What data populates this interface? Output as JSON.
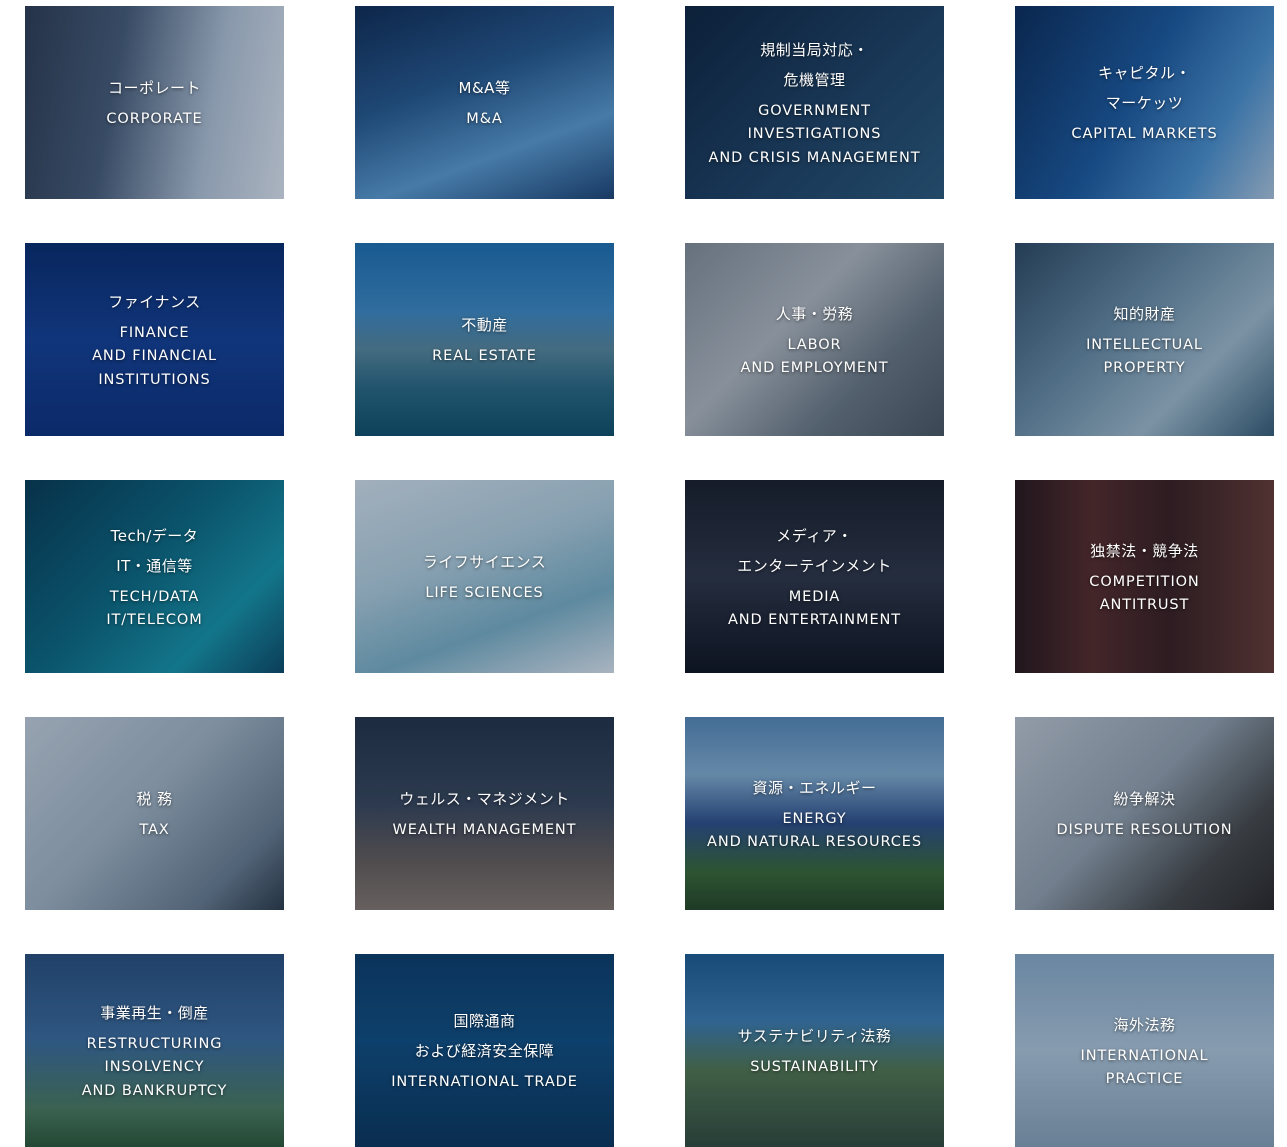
{
  "tiles": [
    {
      "jp": "コーポレート",
      "en": "CORPORATE"
    },
    {
      "jp": "M&A等",
      "en": "M&A"
    },
    {
      "jp": "規制当局対応・\n危機管理",
      "en": "GOVERNMENT\nINVESTIGATIONS\nAND CRISIS MANAGEMENT"
    },
    {
      "jp": "キャピタル・\nマーケッツ",
      "en": "CAPITAL MARKETS"
    },
    {
      "jp": "ファイナンス",
      "en": "FINANCE\nAND FINANCIAL\nINSTITUTIONS"
    },
    {
      "jp": "不動産",
      "en": "REAL ESTATE"
    },
    {
      "jp": "人事・労務",
      "en": "LABOR\nAND EMPLOYMENT"
    },
    {
      "jp": "知的財産",
      "en": "INTELLECTUAL\nPROPERTY"
    },
    {
      "jp": "Tech/データ\nIT・通信等",
      "en": "TECH/DATA\nIT/TELECOM"
    },
    {
      "jp": "ライフサイエンス",
      "en": "LIFE SCIENCES"
    },
    {
      "jp": "メディア・\nエンターテインメント",
      "en": "MEDIA\nAND ENTERTAINMENT"
    },
    {
      "jp": "独禁法・競争法",
      "en": "COMPETITION\nANTITRUST"
    },
    {
      "jp": "税 務",
      "en": "TAX"
    },
    {
      "jp": "ウェルス・マネジメント",
      "en": "WEALTH MANAGEMENT"
    },
    {
      "jp": "資源・エネルギー",
      "en": "ENERGY\nAND NATURAL RESOURCES"
    },
    {
      "jp": "紛争解決",
      "en": "DISPUTE RESOLUTION"
    },
    {
      "jp": "事業再生・倒産",
      "en": "RESTRUCTURING\nINSOLVENCY\nAND BANKRUPTCY"
    },
    {
      "jp": "国際通商\nおよび経済安全保障",
      "en": "INTERNATIONAL TRADE"
    },
    {
      "jp": "サステナビリティ法務",
      "en": "SUSTAINABILITY"
    },
    {
      "jp": "海外法務",
      "en": "INTERNATIONAL\nPRACTICE"
    }
  ]
}
